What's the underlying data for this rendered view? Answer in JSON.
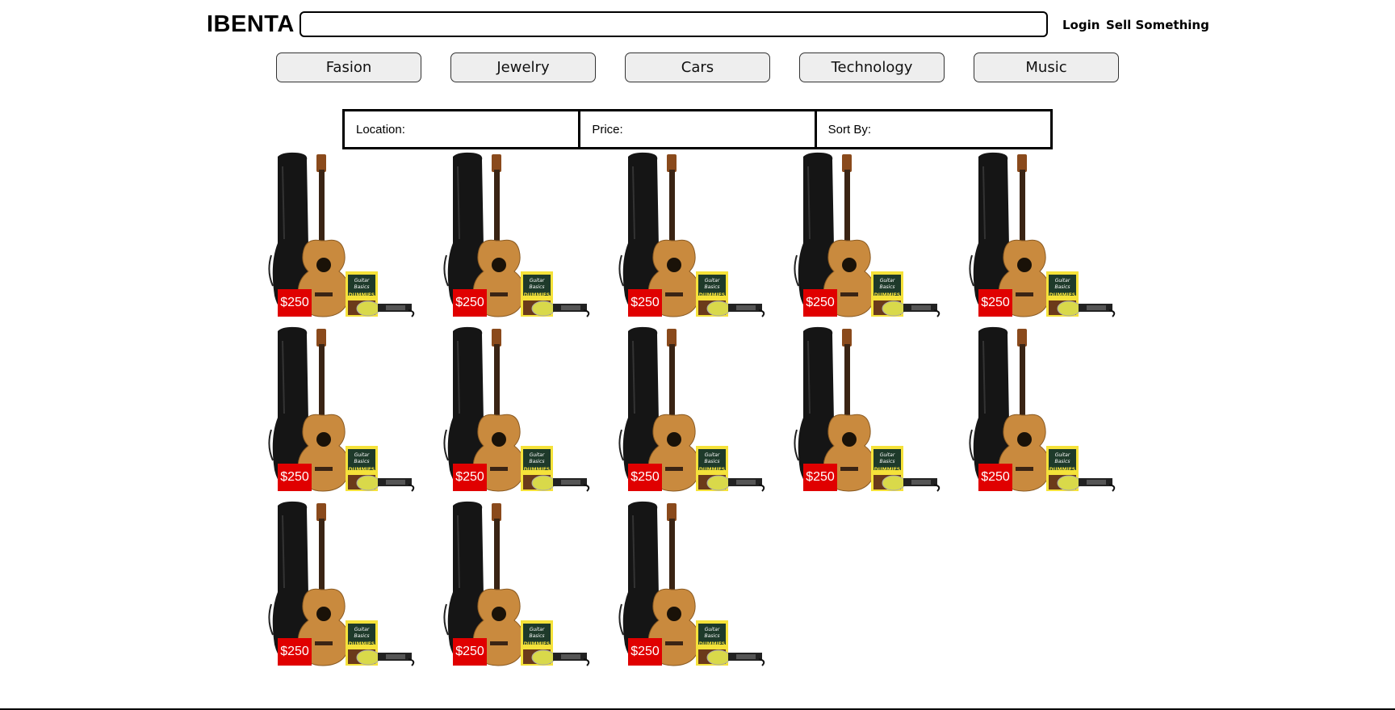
{
  "header": {
    "logo": "IBENTA",
    "search": {
      "value": "",
      "placeholder": ""
    },
    "login": "Login",
    "sell": "Sell Something"
  },
  "categories": [
    "Fasion",
    "Jewelry",
    "Cars",
    "Technology",
    "Music"
  ],
  "filters": {
    "location": "Location:",
    "price": "Price:",
    "sort": "Sort By:"
  },
  "listings": [
    {
      "price": "$250"
    },
    {
      "price": "$250"
    },
    {
      "price": "$250"
    },
    {
      "price": "$250"
    },
    {
      "price": "$250"
    },
    {
      "price": "$250"
    },
    {
      "price": "$250"
    },
    {
      "price": "$250"
    },
    {
      "price": "$250"
    },
    {
      "price": "$250"
    },
    {
      "price": "$250"
    },
    {
      "price": "$250"
    },
    {
      "price": "$250"
    }
  ],
  "product_image": {
    "icon": "acoustic-guitar-bundle-image",
    "book_text": [
      "Guitar",
      "Basics",
      "DUMMIES"
    ]
  },
  "colors": {
    "price_tag": "#e00000",
    "category_bg": "#eeeeee"
  }
}
